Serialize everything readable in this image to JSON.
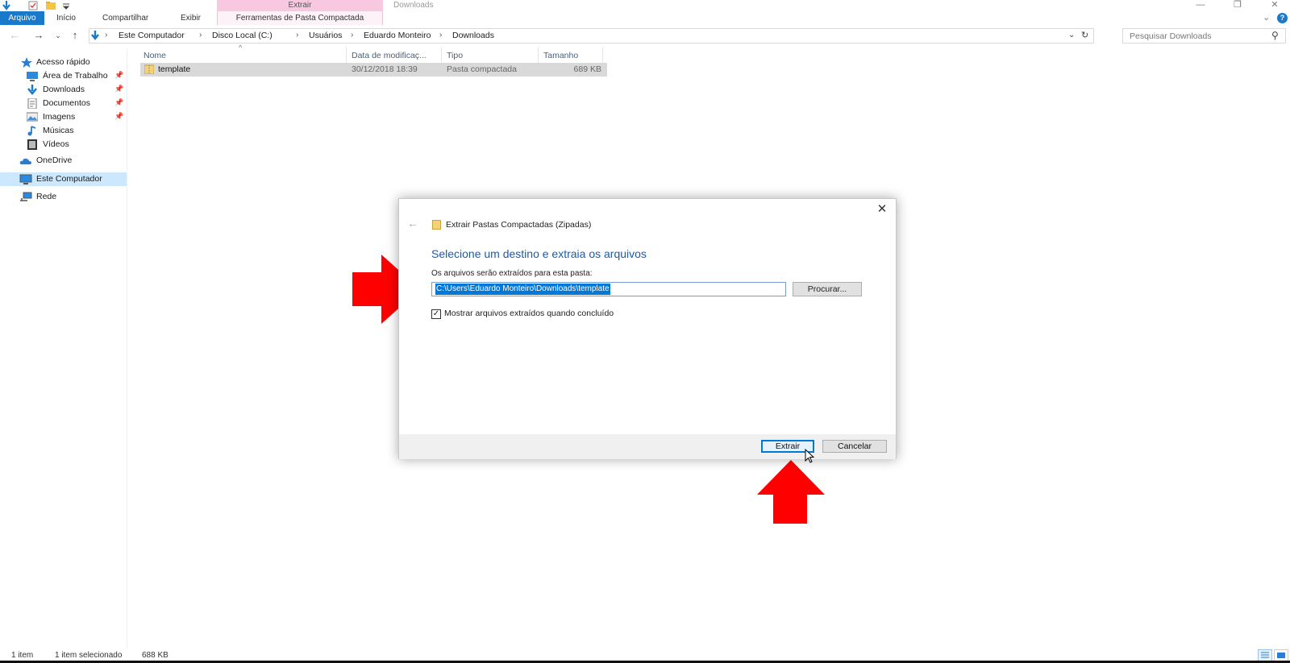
{
  "window": {
    "title": "Downloads",
    "context_header": "Extrair",
    "controls": {
      "minimize": "—",
      "maximize": "❐",
      "close": "✕"
    }
  },
  "ribbon": {
    "tabs": [
      "Arquivo",
      "Início",
      "Compartilhar",
      "Exibir"
    ],
    "context_tab": "Ferramentas de Pasta Compactada",
    "help": "?"
  },
  "address": {
    "crumbs": [
      "Este Computador",
      "Disco Local (C:)",
      "Usuários",
      "Eduardo Monteiro",
      "Downloads"
    ],
    "search_placeholder": "Pesquisar Downloads"
  },
  "nav": {
    "quick_access": "Acesso rápido",
    "items": [
      {
        "label": "Área de Trabalho",
        "pinned": true,
        "icon": "desktop-icon"
      },
      {
        "label": "Downloads",
        "pinned": true,
        "icon": "download-icon"
      },
      {
        "label": "Documentos",
        "pinned": true,
        "icon": "document-icon"
      },
      {
        "label": "Imagens",
        "pinned": true,
        "icon": "picture-icon"
      },
      {
        "label": "Músicas",
        "pinned": false,
        "icon": "music-icon"
      },
      {
        "label": "Vídeos",
        "pinned": false,
        "icon": "video-icon"
      }
    ],
    "onedrive": "OneDrive",
    "this_pc": "Este Computador",
    "network": "Rede"
  },
  "filelist": {
    "columns": [
      "Nome",
      "Data de modificaç...",
      "Tipo",
      "Tamanho"
    ],
    "rows": [
      {
        "name": "template",
        "modified": "30/12/2018 18:39",
        "type": "Pasta compactada",
        "size": "689 KB"
      }
    ]
  },
  "dialog": {
    "title": "Extrair Pastas Compactadas (Zipadas)",
    "heading": "Selecione um destino e extraia os arquivos",
    "path_label": "Os arquivos serão extraídos para esta pasta:",
    "path_value": "C:\\Users\\Eduardo Monteiro\\Downloads\\template",
    "browse_label": "Procurar...",
    "show_files_label": "Mostrar arquivos extraídos quando concluído",
    "show_files_checked": true,
    "extract_label": "Extrair",
    "cancel_label": "Cancelar"
  },
  "status": {
    "count": "1 item",
    "selection": "1 item selecionado",
    "selection_size": "688 KB"
  },
  "colors": {
    "accent": "#1979ca",
    "annotation_arrow": "#ff0000",
    "context_tab": "#f8c8e0",
    "heading": "#1e5aa8"
  }
}
